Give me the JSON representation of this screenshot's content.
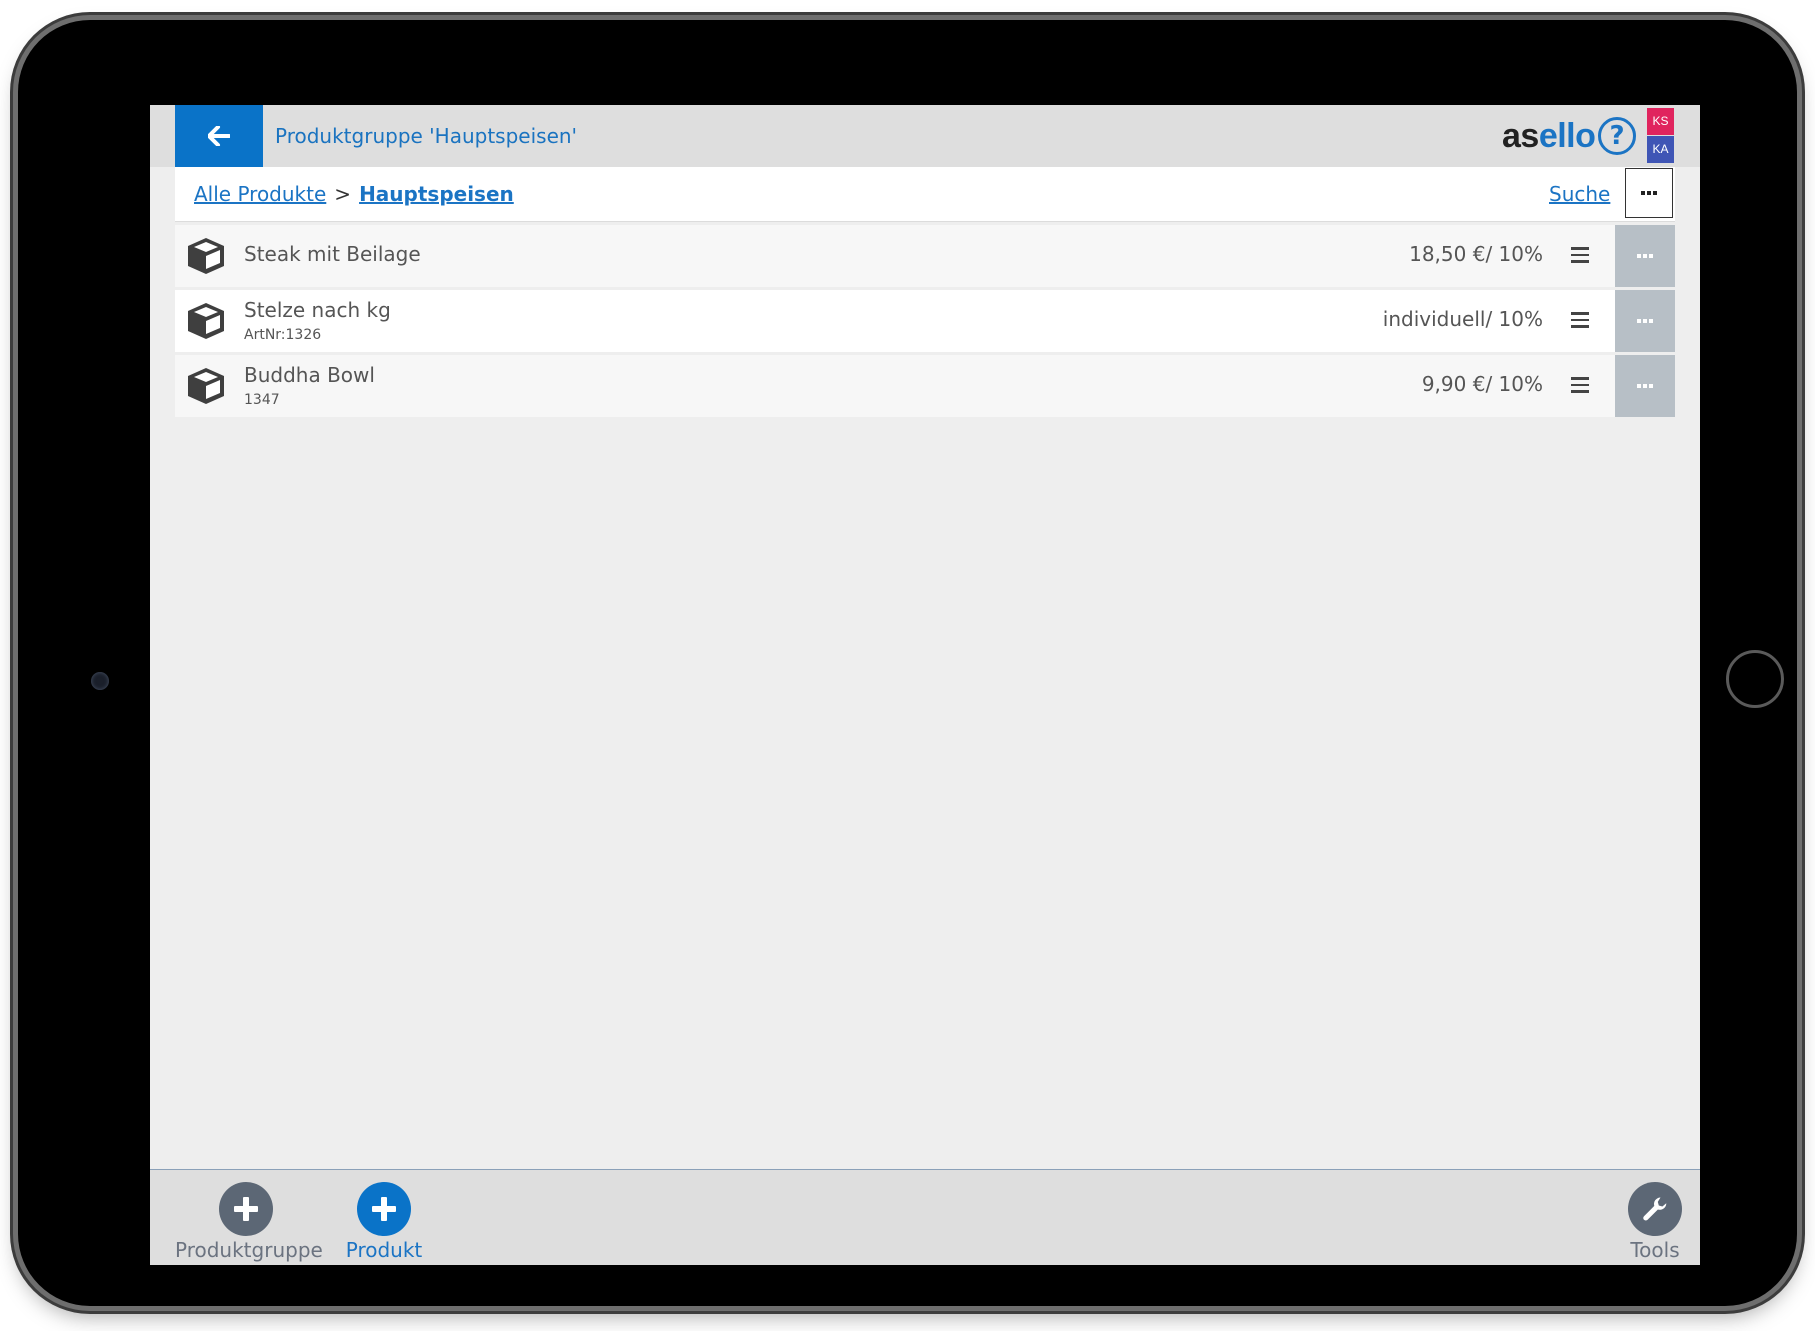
{
  "header": {
    "title": "Produktgruppe 'Hauptspeisen'",
    "brand_part1": "as",
    "brand_part2": "ello",
    "help_symbol": "?",
    "badge_top": "KS",
    "badge_bottom": "KA"
  },
  "breadcrumb": {
    "root": "Alle Produkte",
    "separator": ">",
    "current": "Hauptspeisen",
    "search_link": "Suche"
  },
  "products": [
    {
      "name": "Steak mit Beilage",
      "sub": "",
      "price": "18,50 €/ 10%"
    },
    {
      "name": "Stelze nach kg",
      "sub": "ArtNr:1326",
      "price": "individuell/ 10%"
    },
    {
      "name": "Buddha Bowl",
      "sub": "1347",
      "price": "9,90 €/ 10%"
    }
  ],
  "bottom_bar": {
    "add_group_label": "Produktgruppe",
    "add_product_label": "Produkt",
    "tools_label": "Tools"
  },
  "icons": {
    "back": "arrow-left-icon",
    "product": "box-icon",
    "menu": "hamburger-icon",
    "more": "ellipsis-icon",
    "add": "plus-icon",
    "tools": "wrench-icon"
  },
  "colors": {
    "accent_blue": "#0a73c8",
    "badge_ks": "#e0245e",
    "badge_ka": "#3f55b5",
    "icon_grey": "#5c6775"
  }
}
